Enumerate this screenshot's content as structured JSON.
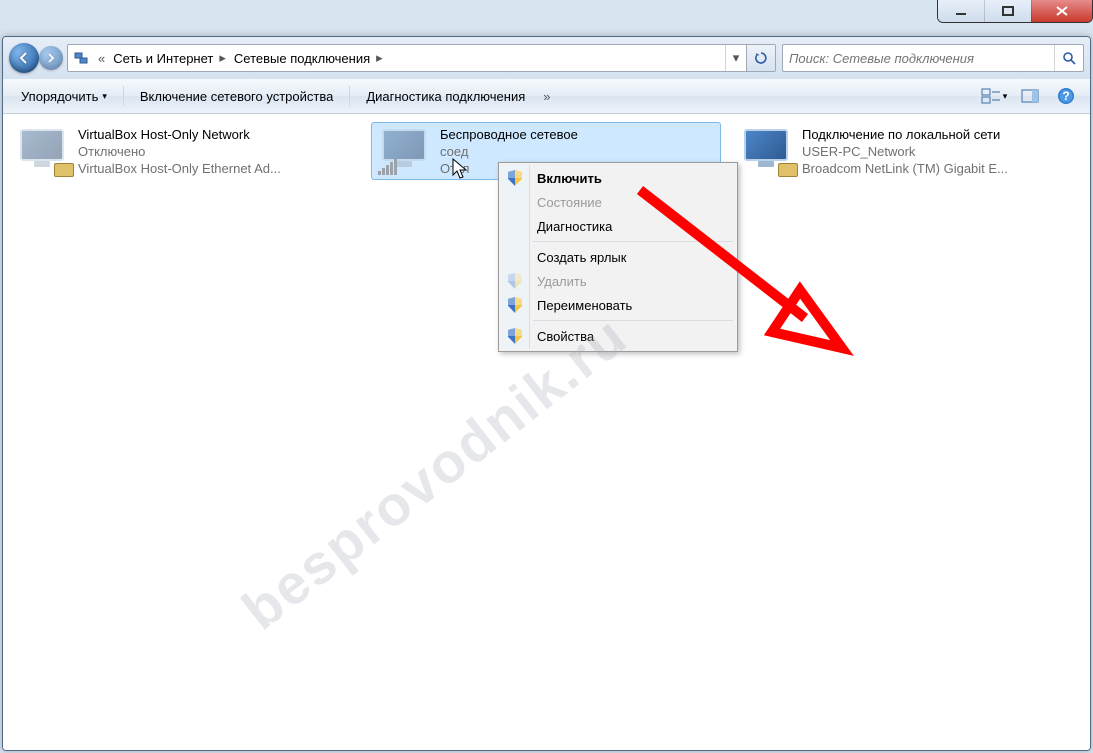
{
  "winctrl": {
    "min": "_",
    "max": "▢",
    "close": "✕"
  },
  "path": {
    "laquo": "«",
    "seg1": "Сеть и Интернет",
    "seg2": "Сетевые подключения",
    "arrow": "▸"
  },
  "search": {
    "placeholder": "Поиск: Сетевые подключения"
  },
  "toolbar": {
    "organize": "Упорядочить",
    "dd": "▾",
    "enable": "Включение сетевого устройства",
    "diagnose": "Диагностика подключения",
    "chev": "»"
  },
  "items": {
    "vbox": {
      "l1": "VirtualBox Host-Only Network",
      "l2": "Отключено",
      "l3": "VirtualBox Host-Only Ethernet Ad..."
    },
    "wlan": {
      "l1": "Беспроводное сетевое",
      "l2": "соед",
      "l3": "Откл"
    },
    "lan": {
      "l1": "Подключение по локальной сети",
      "l2": "USER-PC_Network",
      "l3": "Broadcom NetLink (TM) Gigabit E..."
    }
  },
  "ctx": {
    "enable": "Включить",
    "status": "Состояние",
    "diagnose": "Диагностика",
    "shortcut": "Создать ярлык",
    "delete": "Удалить",
    "rename": "Переименовать",
    "props": "Свойства"
  },
  "watermark": "besprovodnik.ru"
}
